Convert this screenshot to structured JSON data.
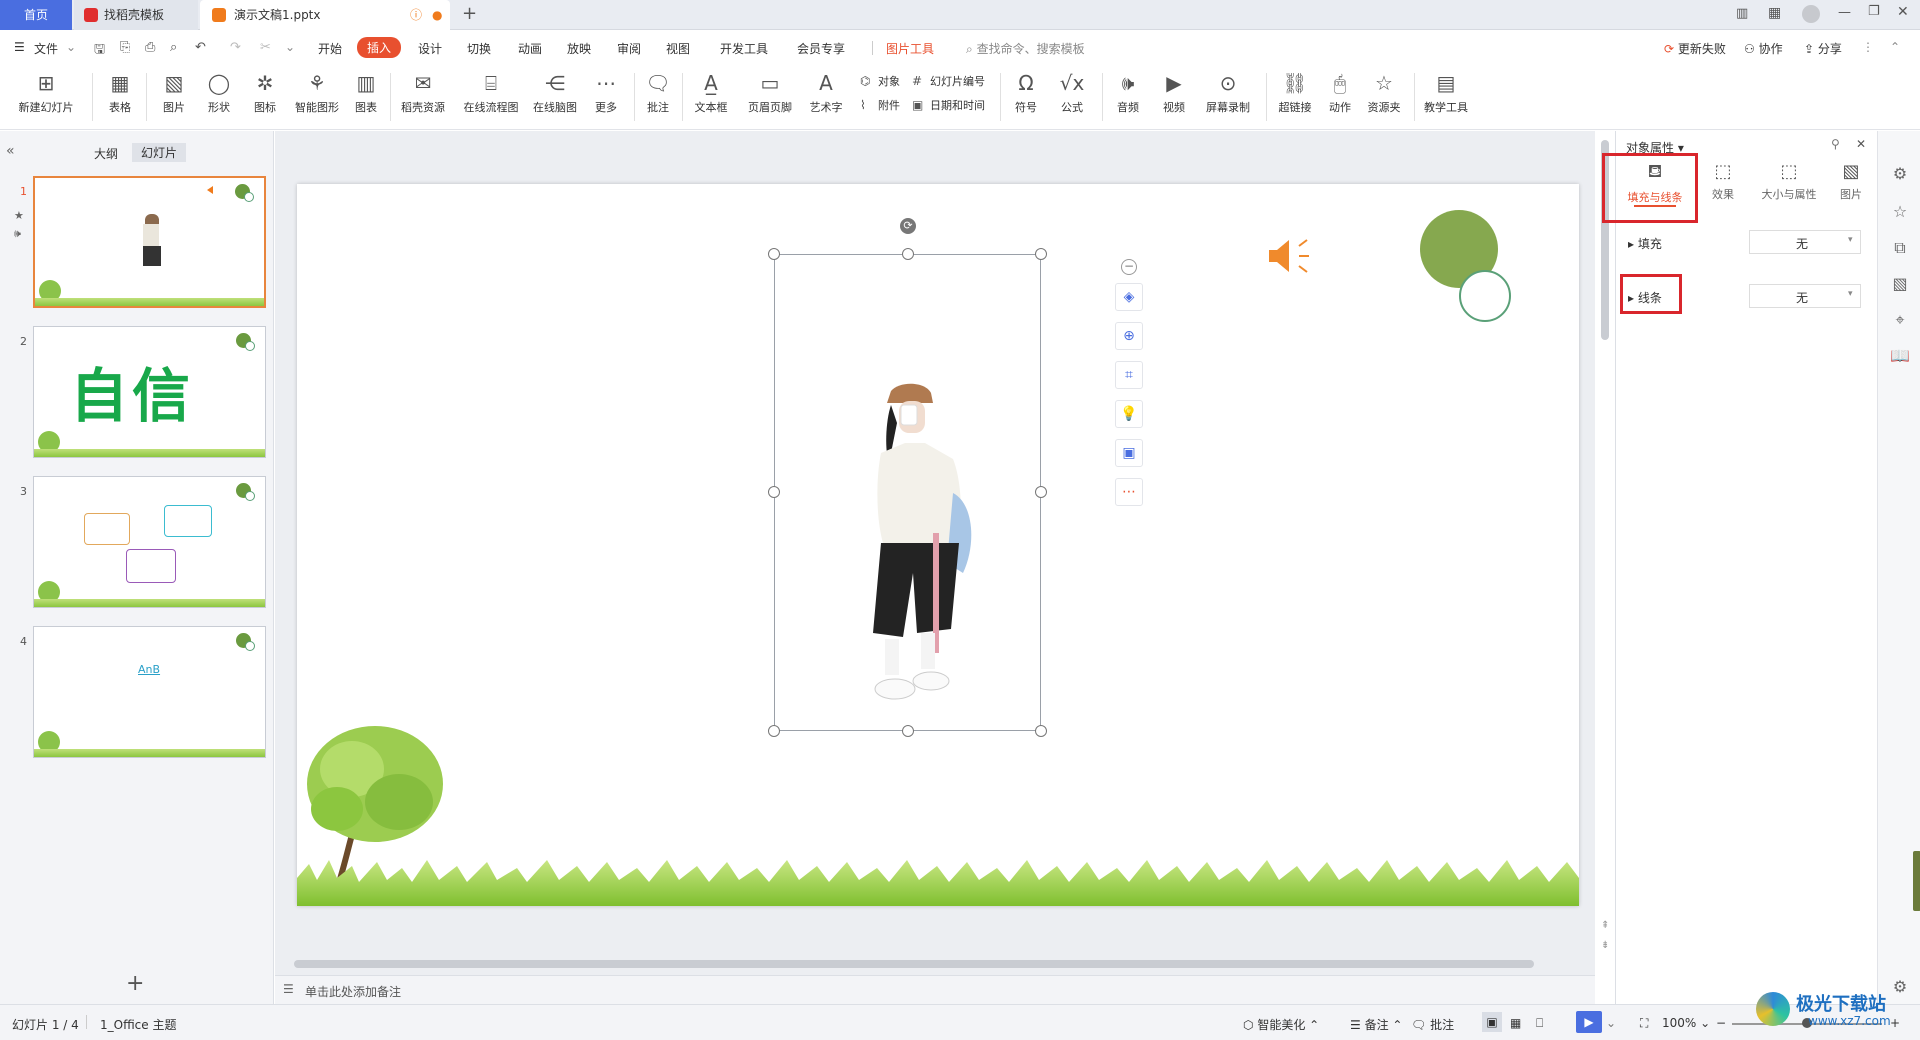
{
  "tabs": {
    "home": "首页",
    "template": "找稻壳模板",
    "document": "演示文稿1.pptx"
  },
  "menu": {
    "file": "文件",
    "items": [
      "开始",
      "插入",
      "设计",
      "切换",
      "动画",
      "放映",
      "审阅",
      "视图",
      "开发工具",
      "会员专享"
    ],
    "active": "插入",
    "picture_tools": "图片工具",
    "search_placeholder": "查找命令、搜索模板",
    "update_failed": "更新失败",
    "collaborate": "协作",
    "share": "分享"
  },
  "ribbon": {
    "new_slide": "新建幻灯片",
    "table": "表格",
    "picture": "图片",
    "shape": "形状",
    "icon": "图标",
    "smart_graphic": "智能图形",
    "chart": "图表",
    "docer_resource": "稻壳资源",
    "online_flowchart": "在线流程图",
    "online_mindmap": "在线脑图",
    "more": "更多",
    "comment": "批注",
    "textbox": "文本框",
    "header_footer": "页眉页脚",
    "wordart": "艺术字",
    "object": "对象",
    "attachment": "附件",
    "slide_number": "幻灯片编号",
    "datetime": "日期和时间",
    "symbol": "符号",
    "formula": "公式",
    "audio": "音频",
    "video": "视频",
    "screen_record": "屏幕录制",
    "hyperlink": "超链接",
    "action": "动作",
    "resource_folder": "资源夹",
    "teaching_tools": "教学工具"
  },
  "left_panel": {
    "outline_tab": "大纲",
    "slides_tab": "幻灯片",
    "slides": [
      {
        "num": "1",
        "selected": true
      },
      {
        "num": "2",
        "text": "自信"
      },
      {
        "num": "3"
      },
      {
        "num": "4",
        "text": "AnB"
      }
    ]
  },
  "notes_placeholder": "单击此处添加备注",
  "right_panel": {
    "title": "对象属性",
    "tabs": [
      "填充与线条",
      "效果",
      "大小与属性",
      "图片"
    ],
    "fill_label": "填充",
    "fill_value": "无",
    "line_label": "线条",
    "line_value": "无"
  },
  "status": {
    "slide_info": "幻灯片 1 / 4",
    "theme": "1_Office 主题",
    "smart_beautify": "智能美化",
    "notes": "备注",
    "comments": "批注",
    "zoom": "100%"
  },
  "watermark": {
    "title": "极光下载站",
    "url": "www.xz7.com"
  },
  "colors": {
    "accent_blue": "#4a6ee0",
    "insert_tab": "#e8502f",
    "picture_tools": "#e8502f",
    "highlight_red": "#d9262c",
    "green_circle": "#86a84f"
  }
}
